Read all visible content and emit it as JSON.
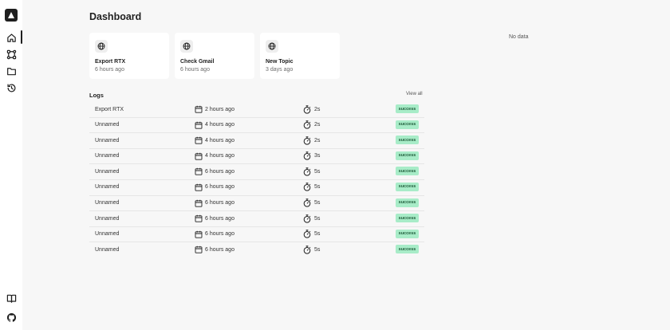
{
  "page": {
    "title": "Dashboard"
  },
  "cards": [
    {
      "title": "Export RTX",
      "time": "6 hours ago",
      "icon": "globe-icon"
    },
    {
      "title": "Check Gmail",
      "time": "6 hours ago",
      "icon": "globe-icon"
    },
    {
      "title": "New Topic",
      "time": "3 days ago",
      "icon": "globe-icon"
    }
  ],
  "stats": {
    "empty_text": "No data"
  },
  "logs": {
    "title": "Logs",
    "view_all": "View all",
    "rows": [
      {
        "name": "Export RTX",
        "date": "2 hours ago",
        "duration": "2s",
        "status": "success"
      },
      {
        "name": "Unnamed",
        "date": "4 hours ago",
        "duration": "2s",
        "status": "success"
      },
      {
        "name": "Unnamed",
        "date": "4 hours ago",
        "duration": "2s",
        "status": "success"
      },
      {
        "name": "Unnamed",
        "date": "4 hours ago",
        "duration": "3s",
        "status": "success"
      },
      {
        "name": "Unnamed",
        "date": "6 hours ago",
        "duration": "5s",
        "status": "success"
      },
      {
        "name": "Unnamed",
        "date": "6 hours ago",
        "duration": "5s",
        "status": "success"
      },
      {
        "name": "Unnamed",
        "date": "6 hours ago",
        "duration": "5s",
        "status": "success"
      },
      {
        "name": "Unnamed",
        "date": "6 hours ago",
        "duration": "5s",
        "status": "success"
      },
      {
        "name": "Unnamed",
        "date": "6 hours ago",
        "duration": "5s",
        "status": "success"
      },
      {
        "name": "Unnamed",
        "date": "6 hours ago",
        "duration": "5s",
        "status": "success"
      }
    ]
  },
  "sidebar": {
    "icons": [
      "home-icon",
      "workflow-icon",
      "folder-icon",
      "history-icon",
      "docs-book-icon",
      "github-icon"
    ]
  },
  "colors": {
    "background": "#f7f7f7",
    "surface": "#ffffff",
    "success_bg": "#a8ecc8",
    "success_text": "#1f5c3a"
  }
}
